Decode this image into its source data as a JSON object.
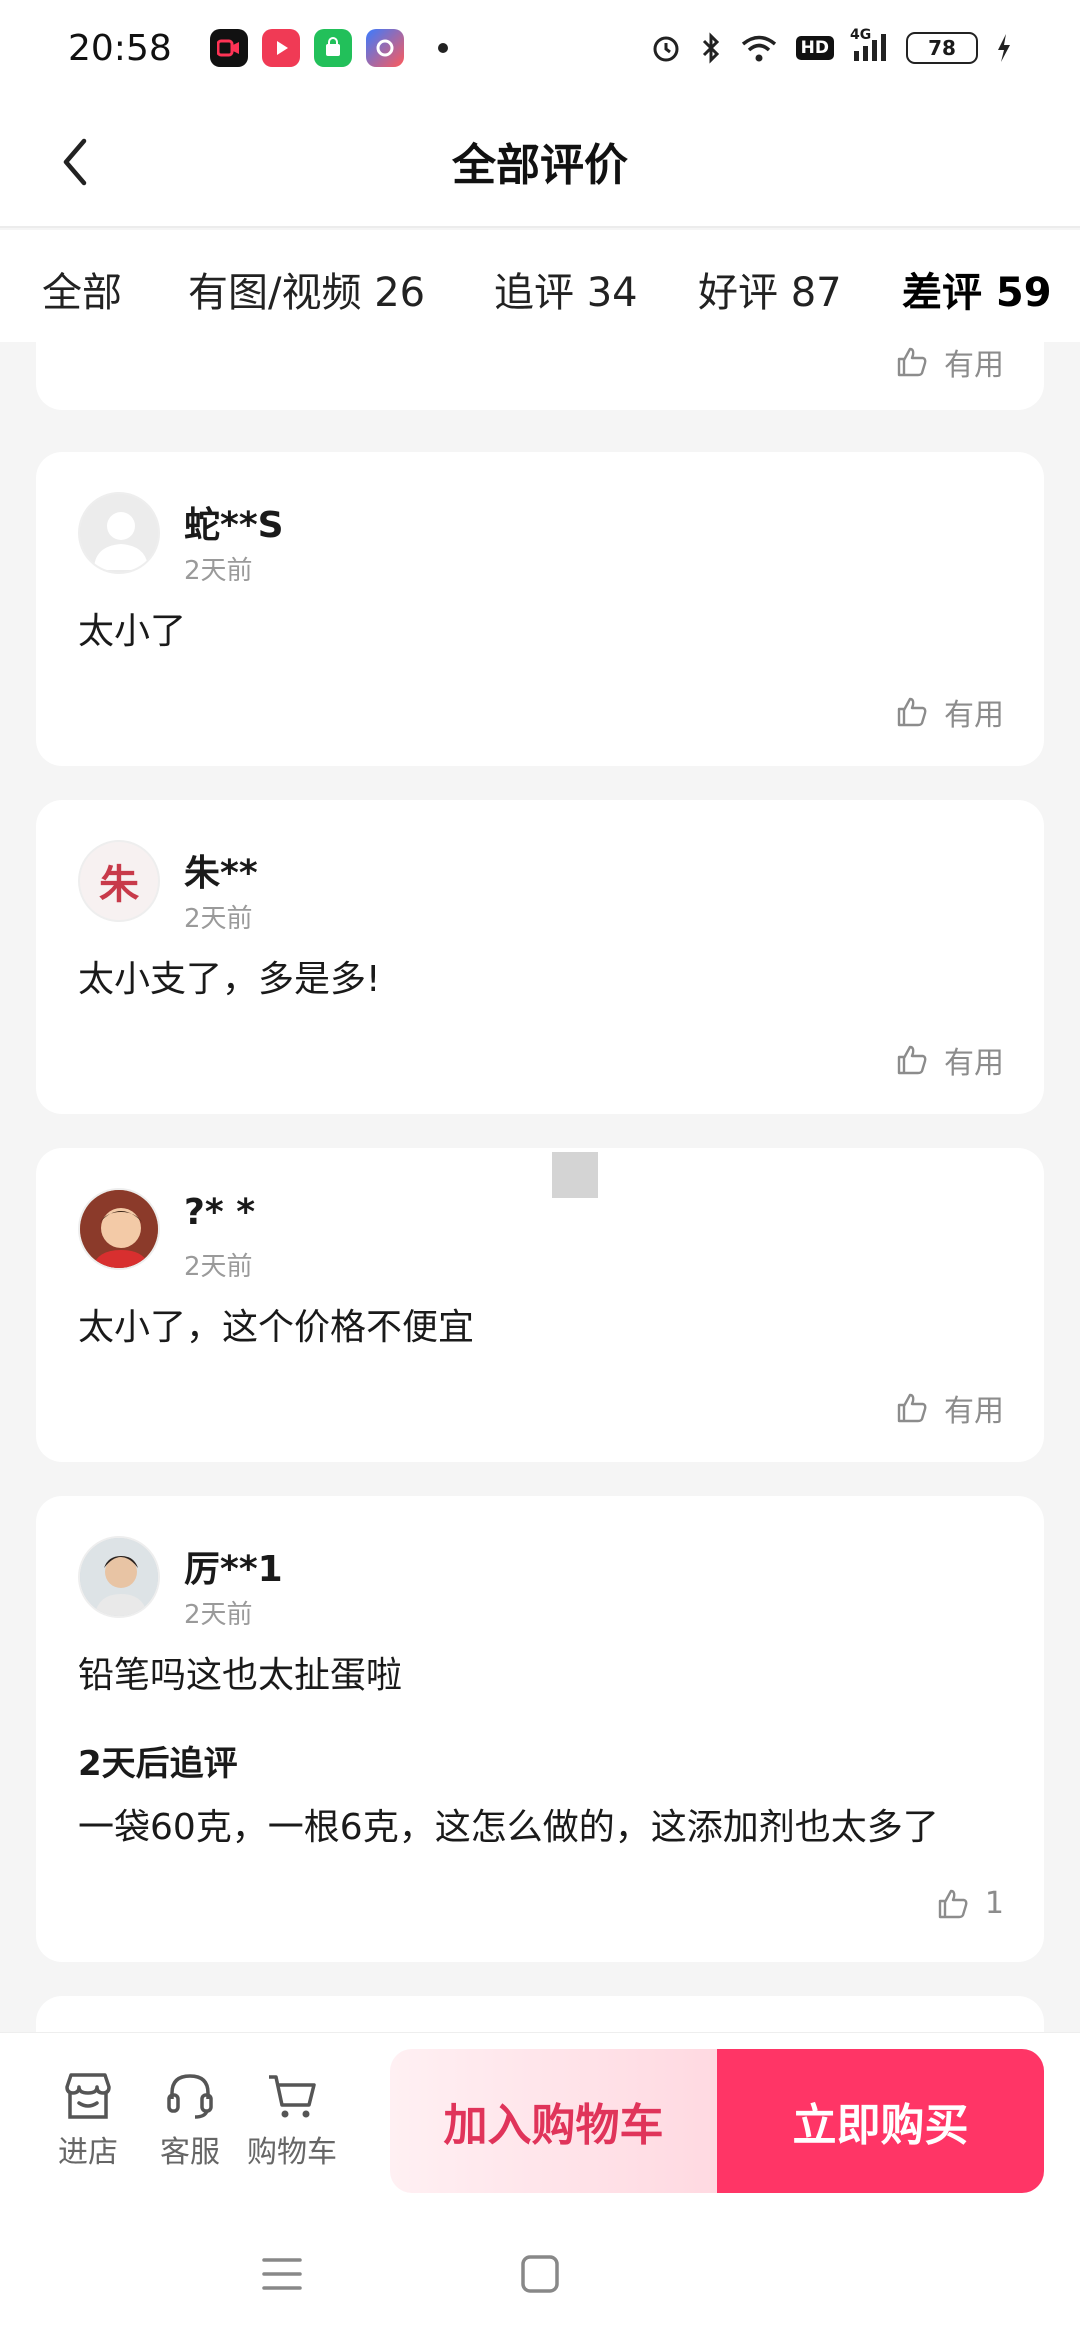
{
  "status_bar": {
    "time": "20:58",
    "battery": "78",
    "network": "4G",
    "hd": "HD"
  },
  "header": {
    "title": "全部评价"
  },
  "tabs": [
    {
      "label": "全部"
    },
    {
      "label": "有图/视频 26"
    },
    {
      "label": "追评 34"
    },
    {
      "label": "好评 87"
    },
    {
      "label": "差评 59"
    }
  ],
  "reviews": [
    {
      "like_label": "有用"
    },
    {
      "username": "蛇**S",
      "time": "2天前",
      "content": "太小了",
      "like_label": "有用"
    },
    {
      "username": "朱**",
      "time": "2天前",
      "content": "太小支了，多是多!",
      "like_label": "有用",
      "avatar_char": "朱"
    },
    {
      "username": "?* *",
      "time": "2天前",
      "content": "太小了，这个价格不便宜",
      "like_label": "有用"
    },
    {
      "username": "厉**1",
      "time": "2天前",
      "content": "铅笔吗这也太扯蛋啦",
      "followup_title": "2天后追评",
      "followup_content": "一袋60克，一根6克，这怎么做的，这添加剂也太多了",
      "like_label": "1"
    }
  ],
  "bottom_bar": {
    "store": "进店",
    "service": "客服",
    "cart": "购物车",
    "add_to_cart": "加入购物车",
    "buy_now": "立即购买"
  },
  "colors": {
    "accent": "#ff3566",
    "accent_light": "#ffd9e1"
  }
}
